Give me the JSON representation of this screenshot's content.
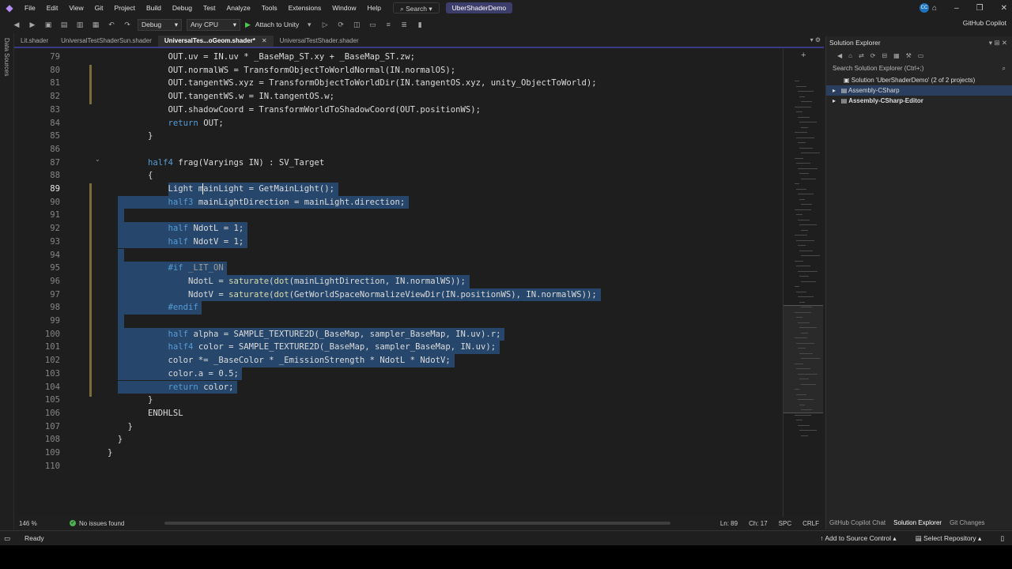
{
  "menu": {
    "items": [
      "File",
      "Edit",
      "View",
      "Git",
      "Project",
      "Build",
      "Debug",
      "Test",
      "Analyze",
      "Tools",
      "Extensions",
      "Window",
      "Help"
    ],
    "search_label": "Search",
    "solution_name": "UberShaderDemo",
    "avatar_initials": "CC"
  },
  "toolbar": {
    "config": "Debug",
    "platform": "Any CPU",
    "attach_label": "Attach to Unity",
    "copilot_label": "GitHub Copilot"
  },
  "left_strip": {
    "label": "Data Sources"
  },
  "tabs": [
    {
      "label": "Lit.shader",
      "active": false
    },
    {
      "label": "UniversalTestShaderSun.shader",
      "active": false
    },
    {
      "label": "UniversalTes...oGeom.shader*",
      "active": true
    },
    {
      "label": "UniversalTestShader.shader",
      "active": false
    }
  ],
  "editor": {
    "current_line": "89",
    "lines": [
      {
        "n": "79",
        "text": "            OUT.uv = IN.uv * _BaseMap_ST.xy + _BaseMap_ST.zw;"
      },
      {
        "n": "80",
        "text": "            OUT.normalWS = TransformObjectToWorldNormal(IN.normalOS);"
      },
      {
        "n": "81",
        "text": "            OUT.tangentWS.xyz = TransformObjectToWorldDir(IN.tangentOS.xyz, unity_ObjectToWorld);"
      },
      {
        "n": "82",
        "text": "            OUT.tangentWS.w = IN.tangentOS.w;"
      },
      {
        "n": "83",
        "text": "            OUT.shadowCoord = TransformWorldToShadowCoord(OUT.positionWS);"
      },
      {
        "n": "84",
        "text": "            return OUT;"
      },
      {
        "n": "85",
        "text": "        }"
      },
      {
        "n": "86",
        "text": ""
      },
      {
        "n": "87",
        "text": "        half4 frag(Varyings IN) : SV_Target"
      },
      {
        "n": "88",
        "text": "        {"
      },
      {
        "n": "89",
        "text": "            Light mainLight = GetMainLight();"
      },
      {
        "n": "90",
        "text": "            half3 mainLightDirection = mainLight.direction;"
      },
      {
        "n": "91",
        "text": ""
      },
      {
        "n": "92",
        "text": "            half NdotL = 1;"
      },
      {
        "n": "93",
        "text": "            half NdotV = 1;"
      },
      {
        "n": "94",
        "text": ""
      },
      {
        "n": "95",
        "text": "            #if _LIT_ON"
      },
      {
        "n": "96",
        "text": "                NdotL = saturate(dot(mainLightDirection, IN.normalWS));"
      },
      {
        "n": "97",
        "text": "                NdotV = saturate(dot(GetWorldSpaceNormalizeViewDir(IN.positionWS), IN.normalWS));"
      },
      {
        "n": "98",
        "text": "            #endif"
      },
      {
        "n": "99",
        "text": ""
      },
      {
        "n": "100",
        "text": "            half alpha = SAMPLE_TEXTURE2D(_BaseMap, sampler_BaseMap, IN.uv).r;"
      },
      {
        "n": "101",
        "text": "            half4 color = SAMPLE_TEXTURE2D(_BaseMap, sampler_BaseMap, IN.uv);"
      },
      {
        "n": "102",
        "text": "            color *= _BaseColor * _EmissionStrength * NdotL * NdotV;"
      },
      {
        "n": "103",
        "text": "            color.a = 0.5;"
      },
      {
        "n": "104",
        "text": "            return color;"
      },
      {
        "n": "105",
        "text": "        }"
      },
      {
        "n": "106",
        "text": "        ENDHLSL"
      },
      {
        "n": "107",
        "text": "    }"
      },
      {
        "n": "108",
        "text": "  }"
      },
      {
        "n": "109",
        "text": "}"
      },
      {
        "n": "110",
        "text": ""
      }
    ],
    "selection": {
      "from_line": "89",
      "to_line": "104"
    }
  },
  "editor_status": {
    "zoom": "146 %",
    "issues": "No issues found",
    "ln": "Ln: 89",
    "ch": "Ch: 17",
    "spc": "SPC",
    "eol": "CRLF"
  },
  "solution_explorer": {
    "title": "Solution Explorer",
    "search_placeholder": "Search Solution Explorer (Ctrl+;)",
    "root": "Solution 'UberShaderDemo' (2 of 2 projects)",
    "projects": [
      "Assembly-CSharp",
      "Assembly-CSharp-Editor"
    ],
    "bottom_tabs": [
      "GitHub Copilot Chat",
      "Solution Explorer",
      "Git Changes"
    ]
  },
  "statusbar": {
    "ready": "Ready",
    "add_source": "Add to Source Control",
    "select_repo": "Select Repository"
  },
  "colors": {
    "selection": "#26466b",
    "keyword": "#569cd6",
    "function": "#dcdcaa",
    "accent": "#3d3d6b"
  }
}
